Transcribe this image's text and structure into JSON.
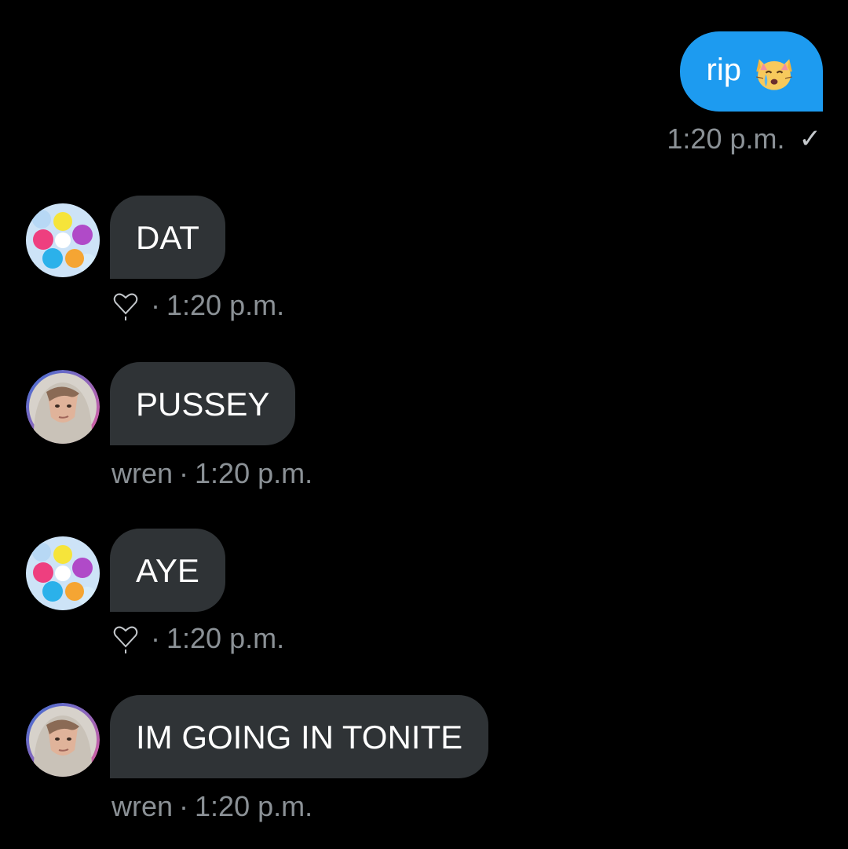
{
  "outgoing": {
    "text": "rip",
    "emoji_icon": "crying-cat-face-icon",
    "time": "1:20 p.m.",
    "check": "✓"
  },
  "messages": [
    {
      "text": "DAT",
      "avatar": "colorful-dots-avatar",
      "reaction_icon": "heart-icon",
      "sep": "·",
      "time": "1:20 p.m."
    },
    {
      "text": "PUSSEY",
      "avatar": "person-hoodie-avatar",
      "sender": "wren",
      "sep": "·",
      "time": "1:20 p.m."
    },
    {
      "text": "AYE",
      "avatar": "colorful-dots-avatar",
      "reaction_icon": "heart-icon",
      "sep": "·",
      "time": "1:20 p.m."
    },
    {
      "text": "IM GOING IN TONITE",
      "avatar": "person-hoodie-avatar",
      "sender": "wren",
      "sep": "·",
      "time": "1:20 p.m."
    }
  ],
  "colors": {
    "background": "#000000",
    "outgoing_bubble": "#1d9bf0",
    "incoming_bubble": "#2f3336",
    "meta_text": "#8b9196"
  }
}
